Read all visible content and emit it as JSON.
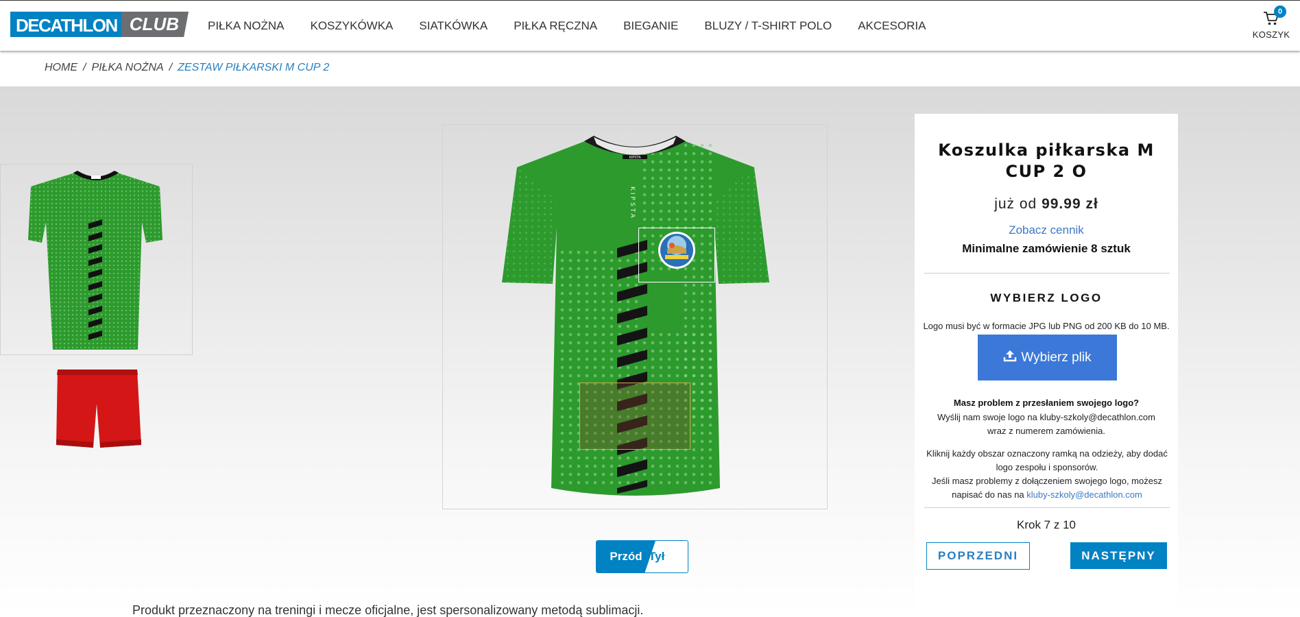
{
  "header": {
    "logo_brand": "DECATHLON",
    "logo_club": "CLUB",
    "nav": [
      "PIŁKA NOŻNA",
      "KOSZYKÓWKA",
      "SIATKÓWKA",
      "PIŁKA RĘCZNA",
      "BIEGANIE",
      "BLUZY / T-SHIRT POLO",
      "AKCESORIA"
    ],
    "cart_count": "0",
    "cart_label": "KOSZYK"
  },
  "breadcrumb": [
    "HOME",
    "PIŁKA NOŻNA",
    "ZESTAW PIŁKARSKI M CUP 2"
  ],
  "breadcrumb_sep": "/",
  "product": {
    "jersey_brand_tag": "KIPSTA",
    "jersey_side_print": "KIPSTA",
    "view_toggle": {
      "front": "Przód",
      "back": "Tył"
    },
    "description": "Produkt przeznaczony na treningi i mecze oficjalne, jest spersonalizowany metodą sublimacji."
  },
  "panel": {
    "title": "Koszulka piłkarska M CUP 2 O",
    "price_prefix": "już od",
    "price": "99.99 zł",
    "pricelist_link": "Zobacz cennik",
    "min_order": "Minimalne zamówienie 8 sztuk",
    "logo_heading": "WYBIERZ LOGO",
    "logo_note": "Logo musi być w formacie JPG lub PNG od 200 KB do 10 MB.",
    "upload_label": "Wybierz plik",
    "problem_q": "Masz problem z przesłaniem swojego logo?",
    "send_text": "Wyślij nam swoje logo na kluby-szkoly@decathlon.com wraz z numerem zamówienia.",
    "click_text": "Kliknij każdy obszar oznaczony ramką na odzieży, aby dodać logo zespołu i sponsorów.",
    "contact_text": "Jeśli masz problemy z dołączeniem swojego logo, możesz napisać do nas na",
    "contact_email": "kluby-szkoly@decathlon.com",
    "step": "Krok 7 z 10",
    "prev": "POPRZEDNI",
    "next": "NASTĘPNY"
  },
  "colors": {
    "brand_blue": "#0082c3",
    "jersey_green": "#2d9a2d",
    "shorts_red": "#d41616",
    "link_blue": "#3b78c4"
  },
  "icons": [
    "cart-icon",
    "upload-icon"
  ]
}
